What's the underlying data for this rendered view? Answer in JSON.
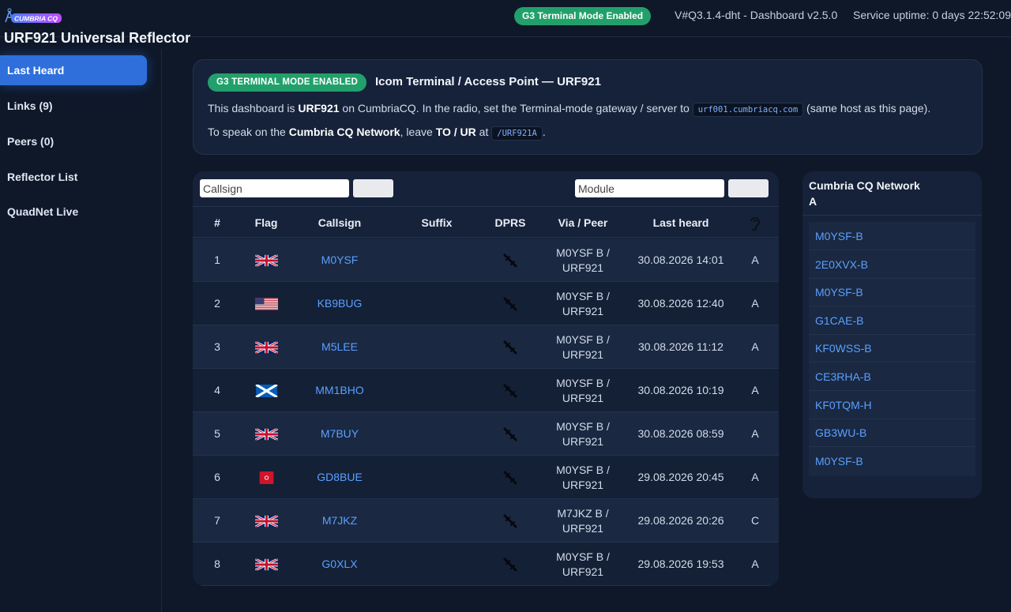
{
  "header": {
    "logo_text": "CUMBRIA CQ",
    "site_title": "URF921 Universal Reflector",
    "terminal_badge": "G3 Terminal Mode Enabled",
    "version": "V#Q3.1.4-dht - Dashboard v2.5.0",
    "uptime": "Service uptime: 0 days 22:52:09"
  },
  "sidebar": {
    "items": [
      {
        "label": "Last Heard",
        "active": true
      },
      {
        "label": "Links (9)",
        "active": false
      },
      {
        "label": "Peers (0)",
        "active": false
      },
      {
        "label": "Reflector List",
        "active": false
      },
      {
        "label": "QuadNet Live",
        "active": false
      }
    ]
  },
  "info": {
    "badge": "G3 TERMINAL MODE ENABLED",
    "title": "Icom Terminal / Access Point — URF921",
    "line1_a": "This dashboard is ",
    "line1_reflector": "URF921",
    "line1_b": " on CumbriaCQ. In the radio, set the Terminal-mode gateway / server to ",
    "line1_host": "urf001.cumbriacq.com",
    "line1_c": " (same host as this page).",
    "line2_a": "To speak on the ",
    "line2_network": "Cumbria CQ Network",
    "line2_b": ", leave ",
    "line2_field": "TO / UR",
    "line2_c": " at ",
    "line2_code": "/URF921A",
    "line2_d": "."
  },
  "filters": {
    "callsign_placeholder": "Callsign",
    "module_placeholder": "Module"
  },
  "table": {
    "columns": [
      "#",
      "Flag",
      "Callsign",
      "Suffix",
      "DPRS",
      "Via / Peer",
      "Last heard",
      "ear-icon"
    ],
    "rows": [
      {
        "num": "1",
        "flag": "gb",
        "callsign": "M0YSF",
        "suffix": "",
        "via_line1": "M0YSF B /",
        "via_line2": "URF921",
        "last_heard": "30.08.2026 14:01",
        "module": "A"
      },
      {
        "num": "2",
        "flag": "us",
        "callsign": "KB9BUG",
        "suffix": "",
        "via_line1": "M0YSF B /",
        "via_line2": "URF921",
        "last_heard": "30.08.2026 12:40",
        "module": "A"
      },
      {
        "num": "3",
        "flag": "gb",
        "callsign": "M5LEE",
        "suffix": "",
        "via_line1": "M0YSF B /",
        "via_line2": "URF921",
        "last_heard": "30.08.2026 11:12",
        "module": "A"
      },
      {
        "num": "4",
        "flag": "scotland",
        "callsign": "MM1BHO",
        "suffix": "",
        "via_line1": "M0YSF B /",
        "via_line2": "URF921",
        "last_heard": "30.08.2026 10:19",
        "module": "A"
      },
      {
        "num": "5",
        "flag": "gb",
        "callsign": "M7BUY",
        "suffix": "",
        "via_line1": "M0YSF B /",
        "via_line2": "URF921",
        "last_heard": "30.08.2026 08:59",
        "module": "A"
      },
      {
        "num": "6",
        "flag": "isle-of-man",
        "callsign": "GD8BUE",
        "suffix": "",
        "via_line1": "M0YSF B /",
        "via_line2": "URF921",
        "last_heard": "29.08.2026 20:45",
        "module": "A"
      },
      {
        "num": "7",
        "flag": "gb",
        "callsign": "M7JKZ",
        "suffix": "",
        "via_line1": "M7JKZ B /",
        "via_line2": "URF921",
        "last_heard": "29.08.2026 20:26",
        "module": "C"
      },
      {
        "num": "8",
        "flag": "gb",
        "callsign": "G0XLX",
        "suffix": "",
        "via_line1": "M0YSF B /",
        "via_line2": "URF921",
        "last_heard": "29.08.2026 19:53",
        "module": "A"
      }
    ]
  },
  "network": {
    "title": "Cumbria CQ Network",
    "module": "A",
    "stations": [
      "M0YSF-B",
      "2E0XVX-B",
      "M0YSF-B",
      "G1CAE-B",
      "KF0WSS-B",
      "CE3RHA-B",
      "KF0TQM-H",
      "GB3WU-B",
      "M0YSF-B"
    ]
  },
  "colors": {
    "background": "#0f1829",
    "card": "#16223a",
    "accent_blue": "#2f6fdc",
    "link_blue": "#5aa0ff",
    "badge_green": "#22a06b"
  }
}
